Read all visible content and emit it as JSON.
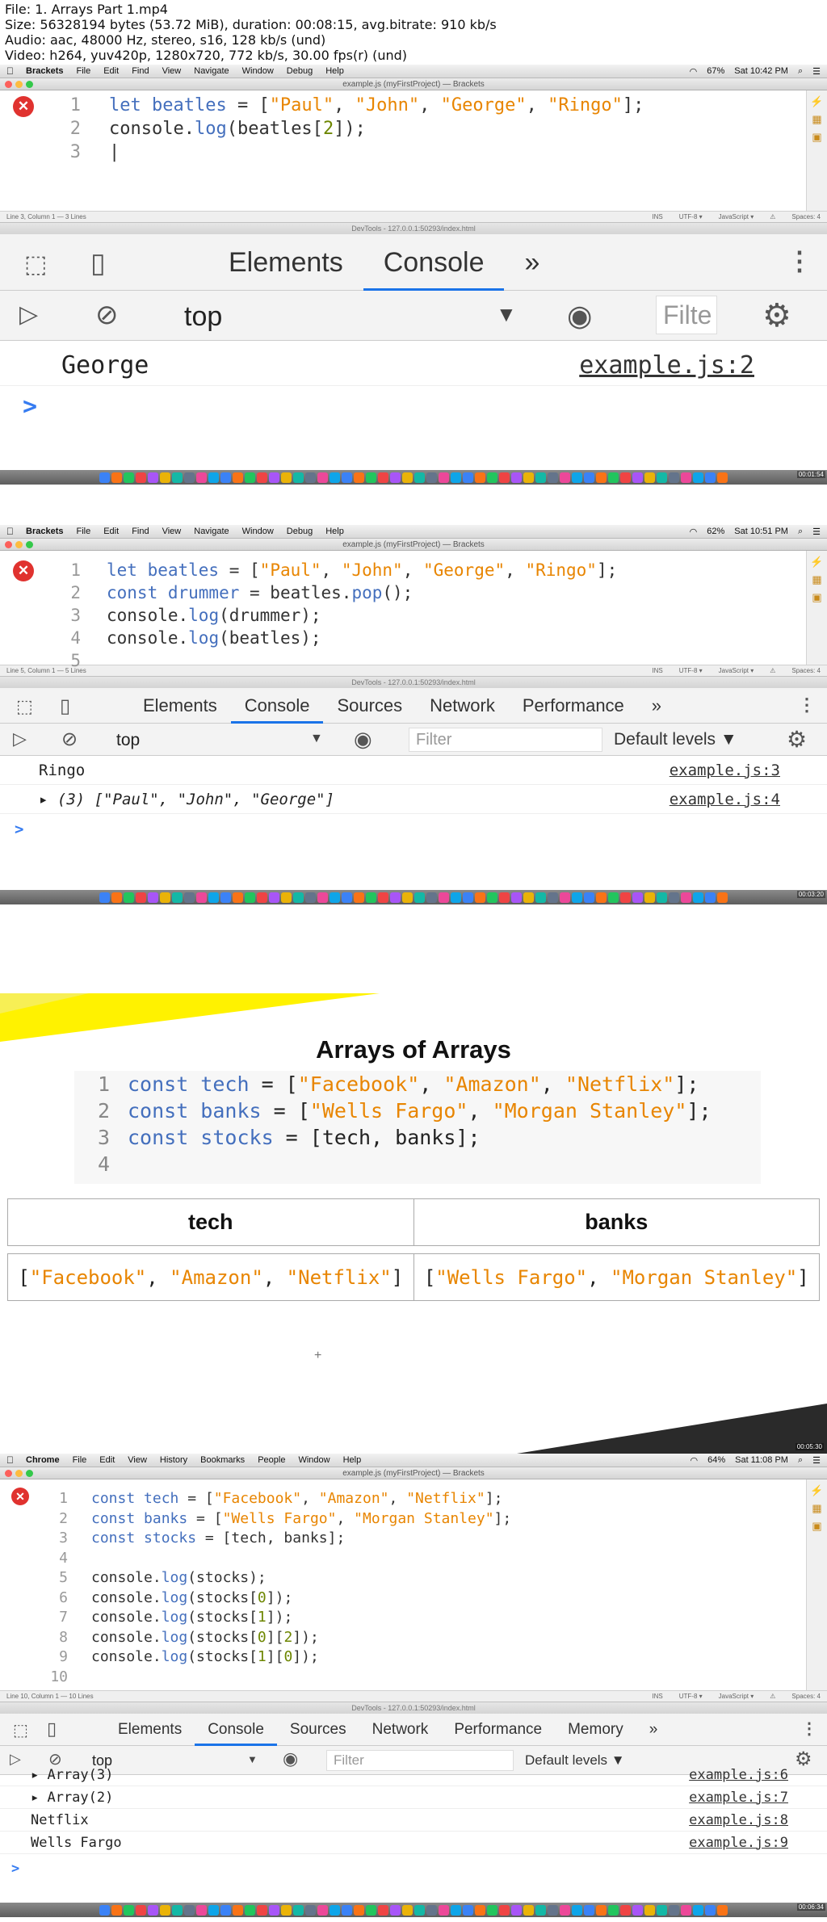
{
  "file_info": {
    "line1": "File: 1. Arrays Part 1.mp4",
    "line2": "Size: 56328194 bytes (53.72 MiB), duration: 00:08:15, avg.bitrate: 910 kb/s",
    "line3": "Audio: aac, 48000 Hz, stereo, s16, 128 kb/s (und)",
    "line4": "Video: h264, yuv420p, 1280x720, 772 kb/s, 30.00 fps(r) (und)"
  },
  "frame1": {
    "menubar": {
      "app": "Brackets",
      "menus": [
        "File",
        "Edit",
        "Find",
        "View",
        "Navigate",
        "Window",
        "Debug",
        "Help"
      ],
      "battery": "67%",
      "time": "Sat 10:42 PM"
    },
    "window_title": "example.js (myFirstProject) — Brackets",
    "code": [
      {
        "n": "1",
        "parts": [
          [
            "kw",
            "let "
          ],
          [
            "kw",
            "beatles"
          ],
          [
            "",
            " = ["
          ],
          [
            "str",
            "\"Paul\""
          ],
          [
            "",
            ", "
          ],
          [
            "str",
            "\"John\""
          ],
          [
            "",
            ", "
          ],
          [
            "str",
            "\"George\""
          ],
          [
            "",
            ", "
          ],
          [
            "str",
            "\"Ringo\""
          ],
          [
            "",
            "];"
          ]
        ]
      },
      {
        "n": "2",
        "parts": [
          [
            "",
            "console."
          ],
          [
            "fn",
            "log"
          ],
          [
            "",
            "(beatles["
          ],
          [
            "num",
            "2"
          ],
          [
            "",
            "]);"
          ]
        ]
      },
      {
        "n": "3",
        "parts": [
          [
            "",
            "|"
          ]
        ]
      }
    ],
    "status": {
      "left": "Line 3, Column 1 — 3 Lines",
      "ins": "INS",
      "enc": "UTF-8 ▾",
      "lang": "JavaScript ▾",
      "spaces": "Spaces: 4"
    },
    "devtools_title": "DevTools - 127.0.0.1:50293/index.html",
    "tabs": [
      "Elements",
      "Console",
      "»"
    ],
    "active_tab": "Console",
    "context": "top",
    "filter": "Filte",
    "rows": [
      {
        "msg": "George",
        "src": "example.js:2"
      }
    ]
  },
  "frame2": {
    "menubar": {
      "app": "Brackets",
      "menus": [
        "File",
        "Edit",
        "Find",
        "View",
        "Navigate",
        "Window",
        "Debug",
        "Help"
      ],
      "battery": "62%",
      "time": "Sat 10:51 PM"
    },
    "window_title": "example.js (myFirstProject) — Brackets",
    "code": [
      {
        "n": "1",
        "parts": [
          [
            "kw",
            "let "
          ],
          [
            "kw",
            "beatles"
          ],
          [
            "",
            " = ["
          ],
          [
            "str",
            "\"Paul\""
          ],
          [
            "",
            ", "
          ],
          [
            "str",
            "\"John\""
          ],
          [
            "",
            ", "
          ],
          [
            "str",
            "\"George\""
          ],
          [
            "",
            ", "
          ],
          [
            "str",
            "\"Ringo\""
          ],
          [
            "",
            "];"
          ]
        ]
      },
      {
        "n": "2",
        "parts": [
          [
            "kw",
            "const "
          ],
          [
            "kw",
            "drummer"
          ],
          [
            "",
            " = beatles."
          ],
          [
            "fn",
            "pop"
          ],
          [
            "",
            "();"
          ]
        ]
      },
      {
        "n": "3",
        "parts": [
          [
            "",
            "console."
          ],
          [
            "fn",
            "log"
          ],
          [
            "",
            "(drummer);"
          ]
        ]
      },
      {
        "n": "4",
        "parts": [
          [
            "",
            "console."
          ],
          [
            "fn",
            "log"
          ],
          [
            "",
            "(beatles);"
          ]
        ]
      },
      {
        "n": "5",
        "parts": [
          [
            "",
            ""
          ]
        ]
      }
    ],
    "status": {
      "left": "Line 5, Column 1 — 5 Lines",
      "ins": "INS",
      "enc": "UTF-8 ▾",
      "lang": "JavaScript ▾",
      "spaces": "Spaces: 4"
    },
    "devtools_title": "DevTools - 127.0.0.1:50293/index.html",
    "tabs": [
      "Elements",
      "Console",
      "Sources",
      "Network",
      "Performance",
      "»"
    ],
    "active_tab": "Console",
    "context": "top",
    "filter": "Filter",
    "levels": "Default levels ▼",
    "rows": [
      {
        "msg": "Ringo",
        "src": "example.js:3"
      },
      {
        "msg": "▸ (3) [\"Paul\", \"John\", \"George\"]",
        "src": "example.js:4"
      }
    ]
  },
  "slide": {
    "title": "Arrays of Arrays",
    "code": [
      {
        "n": "1",
        "parts": [
          [
            "kw",
            "const tech"
          ],
          [
            "",
            " = ["
          ],
          [
            "str",
            "\"Facebook\""
          ],
          [
            "",
            ", "
          ],
          [
            "str",
            "\"Amazon\""
          ],
          [
            "",
            ", "
          ],
          [
            "str",
            "\"Netflix\""
          ],
          [
            "",
            "];"
          ]
        ]
      },
      {
        "n": "2",
        "parts": [
          [
            "kw",
            "const banks"
          ],
          [
            "",
            " = ["
          ],
          [
            "str",
            "\"Wells Fargo\""
          ],
          [
            "",
            ", "
          ],
          [
            "str",
            "\"Morgan Stanley\""
          ],
          [
            "",
            "];"
          ]
        ]
      },
      {
        "n": "3",
        "parts": [
          [
            "kw",
            "const stocks"
          ],
          [
            "",
            " = [tech, banks];"
          ]
        ]
      },
      {
        "n": "4",
        "parts": [
          [
            "",
            ""
          ]
        ]
      }
    ],
    "table_headers": [
      "tech",
      "banks"
    ],
    "table_cells": [
      [
        [
          "",
          "["
        ],
        [
          "str",
          "\"Facebook\""
        ],
        [
          "",
          ", "
        ],
        [
          "str",
          "\"Amazon\""
        ],
        [
          "",
          ", "
        ],
        [
          "str",
          "\"Netflix\""
        ],
        [
          "",
          "]"
        ]
      ],
      [
        [
          "",
          "["
        ],
        [
          "str",
          "\"Wells Fargo\""
        ],
        [
          "",
          ", "
        ],
        [
          "str",
          "\"Morgan Stanley\""
        ],
        [
          "",
          "]"
        ]
      ]
    ],
    "plus": "+"
  },
  "frame4": {
    "menubar": {
      "app": "Chrome",
      "menus": [
        "File",
        "Edit",
        "View",
        "History",
        "Bookmarks",
        "People",
        "Window",
        "Help"
      ],
      "battery": "64%",
      "time": "Sat 11:08 PM"
    },
    "window_title": "example.js (myFirstProject) — Brackets",
    "code": [
      {
        "n": "1",
        "parts": [
          [
            "kw",
            "const tech"
          ],
          [
            "",
            " = ["
          ],
          [
            "str",
            "\"Facebook\""
          ],
          [
            "",
            ", "
          ],
          [
            "str",
            "\"Amazon\""
          ],
          [
            "",
            ", "
          ],
          [
            "str",
            "\"Netflix\""
          ],
          [
            "",
            "];"
          ]
        ]
      },
      {
        "n": "2",
        "parts": [
          [
            "kw",
            "const banks"
          ],
          [
            "",
            " = ["
          ],
          [
            "str",
            "\"Wells Fargo\""
          ],
          [
            "",
            ", "
          ],
          [
            "str",
            "\"Morgan Stanley\""
          ],
          [
            "",
            "];"
          ]
        ]
      },
      {
        "n": "3",
        "parts": [
          [
            "kw",
            "const stocks"
          ],
          [
            "",
            " = [tech, banks];"
          ]
        ]
      },
      {
        "n": "4",
        "parts": [
          [
            "",
            ""
          ]
        ]
      },
      {
        "n": "5",
        "parts": [
          [
            "",
            "console."
          ],
          [
            "fn",
            "log"
          ],
          [
            "",
            "(stocks);"
          ]
        ]
      },
      {
        "n": "6",
        "parts": [
          [
            "",
            "console."
          ],
          [
            "fn",
            "log"
          ],
          [
            "",
            "(stocks["
          ],
          [
            "num",
            "0"
          ],
          [
            "",
            "]);"
          ]
        ]
      },
      {
        "n": "7",
        "parts": [
          [
            "",
            "console."
          ],
          [
            "fn",
            "log"
          ],
          [
            "",
            "(stocks["
          ],
          [
            "num",
            "1"
          ],
          [
            "",
            "]);"
          ]
        ]
      },
      {
        "n": "8",
        "parts": [
          [
            "",
            "console."
          ],
          [
            "fn",
            "log"
          ],
          [
            "",
            "(stocks["
          ],
          [
            "num",
            "0"
          ],
          [
            "",
            "]["
          ],
          [
            "num",
            "2"
          ],
          [
            "",
            "]);"
          ]
        ]
      },
      {
        "n": "9",
        "parts": [
          [
            "",
            "console."
          ],
          [
            "fn",
            "log"
          ],
          [
            "",
            "(stocks["
          ],
          [
            "num",
            "1"
          ],
          [
            "",
            "]["
          ],
          [
            "num",
            "0"
          ],
          [
            "",
            "]);"
          ]
        ]
      },
      {
        "n": "10",
        "parts": [
          [
            "",
            ""
          ]
        ]
      }
    ],
    "status": {
      "left": "Line 10, Column 1 — 10 Lines",
      "ins": "INS",
      "enc": "UTF-8 ▾",
      "lang": "JavaScript ▾",
      "spaces": "Spaces: 4"
    },
    "devtools_title": "DevTools - 127.0.0.1:50293/index.html",
    "tabs": [
      "Elements",
      "Console",
      "Sources",
      "Network",
      "Performance",
      "Memory",
      "»"
    ],
    "active_tab": "Console",
    "context": "top",
    "filter": "Filter",
    "levels": "Default levels ▼",
    "rows": [
      {
        "msg": "▸ Array(3)",
        "src": "example.js:6"
      },
      {
        "msg": "▸ Array(2)",
        "src": "example.js:7"
      },
      {
        "msg": "Netflix",
        "src": "example.js:8"
      },
      {
        "msg": "Wells Fargo",
        "src": "example.js:9"
      }
    ]
  },
  "timestamps": {
    "f1": "00:01:54",
    "f2": "00:03:20",
    "f3": "00:05:30",
    "f4": "00:06:34"
  }
}
